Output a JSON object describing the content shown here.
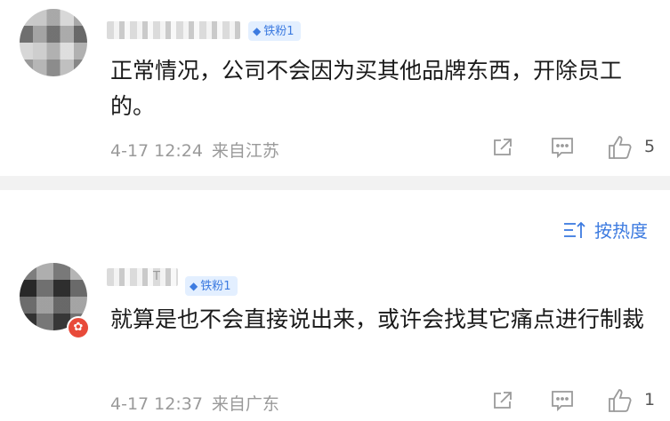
{
  "comments": [
    {
      "badge": "铁粉1",
      "text": "正常情况，公司不会因为买其他品牌东西，开除员工的。",
      "time": "4-17 12:24",
      "location": "来自江苏",
      "likes": "5"
    },
    {
      "username_tail": "T",
      "badge": "铁粉1",
      "text": "就算是也不会直接说出来，或许会找其它痛点进行制裁",
      "time": "4-17 12:37",
      "location": "来自广东",
      "likes": "1"
    }
  ],
  "sort": {
    "label": "按热度"
  },
  "colors": {
    "accent": "#3d7be0",
    "meta": "#9a9a9a",
    "badge_bg": "#e3efff",
    "divider": "#f2f2f2"
  },
  "icons": [
    "share-icon",
    "reply-icon",
    "like-icon",
    "sort-icon",
    "diamond-icon"
  ]
}
